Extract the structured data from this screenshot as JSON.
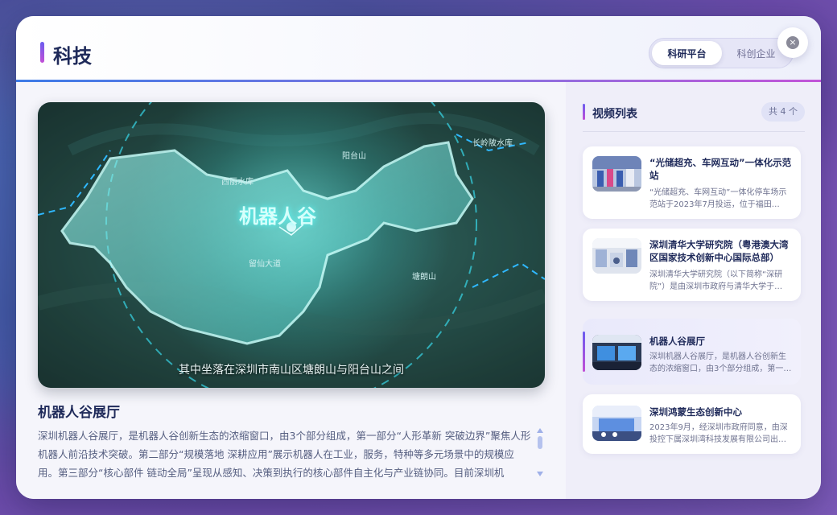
{
  "header": {
    "title": "科技",
    "tabs": [
      {
        "label": "科研平台",
        "active": true
      },
      {
        "label": "科创企业",
        "active": false
      }
    ],
    "close_glyph": "×"
  },
  "player": {
    "map_title": "机器人谷",
    "subtitle": "其中坐落在深圳市南山区塘朗山与阳台山之间",
    "labels": [
      "西丽水库",
      "留仙大道",
      "塘朗山",
      "阳台山",
      "长岭陂水库"
    ]
  },
  "detail": {
    "title": "机器人谷展厅",
    "text": "深圳机器人谷展厅，是机器人谷创新生态的浓缩窗口，由3个部分组成，第一部分“人形革新 突破边界”聚焦人形机器人前沿技术突破。第二部分“规模落地 深耕应用”展示机器人在工业，服务，特种等多元场景中的规模应用。第三部分“核心部件 链动全局”呈现从感知、决策到执行的核心部件自主化与产业链协同。目前深圳机"
  },
  "video_list": {
    "title": "视频列表",
    "count": "共 4 个",
    "items": [
      {
        "title": "“光储超充、车网互动”一体化示范站",
        "desc": "“光储超充、车网互动”一体化停车场示范站于2023年7月投运，位于福田…",
        "active": false,
        "thumb_icon": "ev-charging-station-thumbnail"
      },
      {
        "title": "深圳清华大学研究院（粤港澳大湾区国家技术创新中心国际总部）",
        "desc": "深圳清华大学研究院（以下简称“深研院”）是由深圳市政府与清华大学于…",
        "active": false,
        "thumb_icon": "research-lab-thumbnail"
      },
      {
        "title": "机器人谷展厅",
        "desc": "深圳机器人谷展厅，是机器人谷创新生态的浓缩窗口，由3个部分组成，第一…",
        "active": true,
        "thumb_icon": "exhibition-hall-thumbnail"
      },
      {
        "title": "深圳鸿蒙生态创新中心",
        "desc": "2023年9月，经深圳市政府同意，由深投控下属深圳湾科技发展有限公司出…",
        "active": false,
        "thumb_icon": "innovation-center-thumbnail"
      }
    ]
  }
}
